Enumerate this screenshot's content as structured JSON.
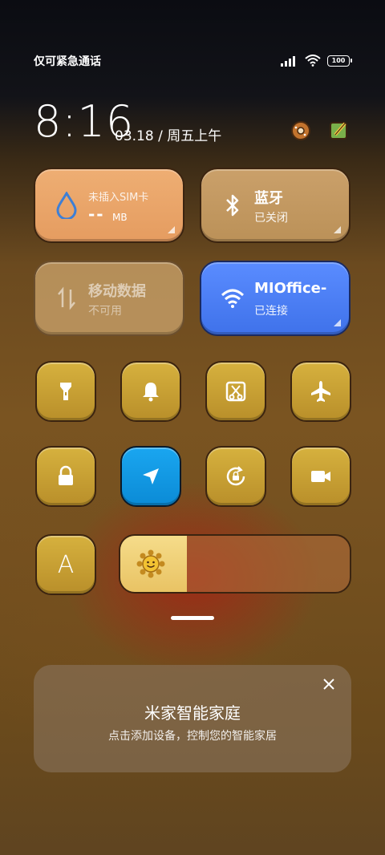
{
  "status_bar": {
    "carrier_text": "仅可紧急通话",
    "battery": "100"
  },
  "header": {
    "time": "8:16",
    "date": "03.18 / 周五上午"
  },
  "tiles": {
    "data_usage": {
      "label": "未插入SIM卡",
      "value": "--",
      "unit": "MB",
      "color": "#e9a36b"
    },
    "bluetooth": {
      "label": "蓝牙",
      "status": "已关闭",
      "color": "#c79a62"
    },
    "mobile_data": {
      "label": "移动数据",
      "status": "不可用",
      "color": "#c8a06a"
    },
    "wifi": {
      "label": "MIOffice-",
      "status": "已连接",
      "color": "#4a7ef5"
    }
  },
  "toggles": [
    {
      "name": "flashlight-icon",
      "active": false
    },
    {
      "name": "bell-icon",
      "active": false
    },
    {
      "name": "screenshot-icon",
      "active": false
    },
    {
      "name": "airplane-icon",
      "active": false
    },
    {
      "name": "lock-icon",
      "active": false
    },
    {
      "name": "location-icon",
      "active": true,
      "color": "#0e9be8"
    },
    {
      "name": "rotation-lock-icon",
      "active": false
    },
    {
      "name": "video-camera-icon",
      "active": false
    }
  ],
  "reading_mode": {
    "label": "A"
  },
  "brightness": {
    "level": 0.29
  },
  "smart_home": {
    "title": "米家智能家庭",
    "subtitle": "点击添加设备，控制您的智能家居"
  }
}
